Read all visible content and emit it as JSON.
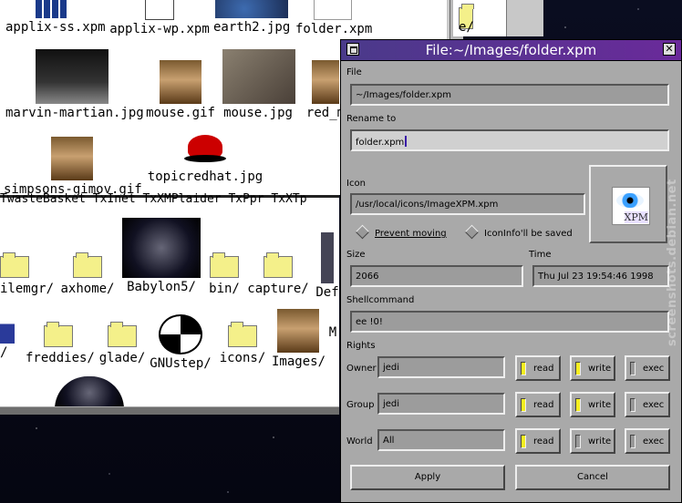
{
  "desktop": {
    "window1_items": [
      {
        "label": "applix-ss.xpm",
        "icon": "spreadsheet-icon"
      },
      {
        "label": "applix-wp.xpm",
        "icon": "document-icon"
      },
      {
        "label": "earth2.jpg",
        "icon": "earth-thumbnail"
      },
      {
        "label": "folder.xpm",
        "icon": "xpm-icon"
      },
      {
        "label": "marvin-martian.jpg",
        "icon": "marvin-thumbnail"
      },
      {
        "label": "mouse.gif",
        "icon": "mona-lisa-thumbnail"
      },
      {
        "label": "mouse.jpg",
        "icon": "mouse-thumbnail"
      },
      {
        "label": "red_m",
        "icon": "red-thumbnail"
      },
      {
        "label": "simpsons-gimov.gif",
        "icon": "mona-lisa-thumbnail"
      },
      {
        "label": "topicredhat.jpg",
        "icon": "redhat-icon"
      }
    ],
    "window2_cutoff": "TwasteBasket  TxInet  TxXMPlaider  TxPpr  TxXTp",
    "window2_items": [
      {
        "label": "ilemgr/",
        "icon": "folder-icon"
      },
      {
        "label": "axhome/",
        "icon": "folder-icon"
      },
      {
        "label": "Babylon5/",
        "icon": "space-thumbnail"
      },
      {
        "label": "bin/",
        "icon": "folder-icon"
      },
      {
        "label": "capture/",
        "icon": "folder-icon"
      },
      {
        "label": "Def",
        "icon": "folder-icon"
      },
      {
        "label": "/",
        "icon": "word-icon"
      },
      {
        "label": "freddies/",
        "icon": "folder-icon"
      },
      {
        "label": "glade/",
        "icon": "folder-icon"
      },
      {
        "label": "GNUstep/",
        "icon": "gnustep-icon"
      },
      {
        "label": "icons/",
        "icon": "folder-icon"
      },
      {
        "label": "Images/",
        "icon": "mona-lisa-thumbnail"
      },
      {
        "label": "M",
        "icon": "folder-icon"
      }
    ],
    "window3_label": "e/"
  },
  "dialog": {
    "title": "File:~/Images/folder.xpm",
    "file_label": "File",
    "file_value": "~/Images/folder.xpm",
    "rename_label": "Rename to",
    "rename_value": "folder.xpm",
    "icon_label": "Icon",
    "icon_value": "/usr/local/icons/ImageXPM.xpm",
    "icon_preview_text": "XPM",
    "prevent_moving": "Prevent moving",
    "iconinfo_saved": "IconInfo'll be saved",
    "size_label": "Size",
    "size_value": "2066",
    "time_label": "Time",
    "time_value": "Thu Jul 23 19:54:46 1998",
    "shell_label": "Shellcommand",
    "shell_value": "ee !0!",
    "rights_label": "Rights",
    "rights": [
      {
        "label": "Owner",
        "value": "jedi",
        "read": true,
        "write": true,
        "exec": false
      },
      {
        "label": "Group",
        "value": "jedi",
        "read": true,
        "write": true,
        "exec": false
      },
      {
        "label": "World",
        "value": "All",
        "read": true,
        "write": false,
        "exec": false
      }
    ],
    "read_label": "read",
    "write_label": "write",
    "exec_label": "exec",
    "apply_label": "Apply",
    "cancel_label": "Cancel",
    "indicator_color": "#f5ee20"
  },
  "watermark": "screenshots.debian.net"
}
